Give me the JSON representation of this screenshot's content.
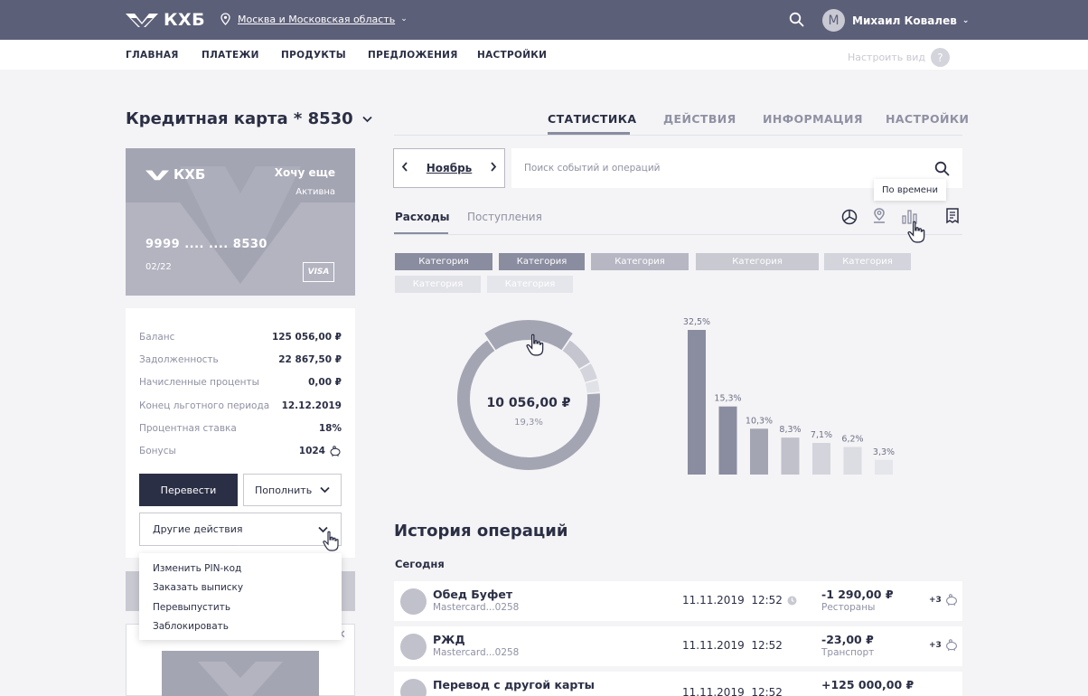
{
  "header": {
    "logo_text": "КХБ",
    "region": "Москва и Московская область",
    "user_initial": "М",
    "user_name": "Михаил Ковалев"
  },
  "nav": {
    "items": [
      {
        "label": "ГЛАВНАЯ"
      },
      {
        "label": "ПЛАТЕЖИ"
      },
      {
        "label": "ПРОДУКТЫ"
      },
      {
        "label": "ПРЕДЛОЖЕНИЯ"
      },
      {
        "label": "НАСТРОЙКИ"
      }
    ],
    "customize_label": "Настроить вид",
    "help_symbol": "?"
  },
  "page": {
    "title": "Кредитная карта * 8530",
    "tabs": [
      {
        "label": "СТАТИСТИКА",
        "active": true
      },
      {
        "label": "ДЕЙСТВИЯ"
      },
      {
        "label": "ИНФОРМАЦИЯ"
      },
      {
        "label": "НАСТРОЙКИ"
      }
    ]
  },
  "card": {
    "logo_text": "КХБ",
    "name": "Хочу еще",
    "status": "Активна",
    "number": "9999 .... .... 8530",
    "expiry": "02/22",
    "brand": "VISA"
  },
  "account": {
    "rows": [
      {
        "label": "Баланс",
        "value": "125 056,00 ₽"
      },
      {
        "label": "Задолженность",
        "value": "22 867,50 ₽"
      },
      {
        "label": "Начисленные проценты",
        "value": "0,00 ₽"
      },
      {
        "label": "Конец льготного периода",
        "value": "12.12.2019"
      },
      {
        "label": "Процентная ставка",
        "value": "18%"
      },
      {
        "label": "Бонусы",
        "value": "1024"
      }
    ],
    "transfer_label": "Перевести",
    "topup_label": "Пополнить",
    "other_label": "Другие действия",
    "other_menu": [
      {
        "label": "Изменить PIN-код"
      },
      {
        "label": "Заказать выписку"
      },
      {
        "label": "Перевыпустить"
      },
      {
        "label": "Заблокировать"
      }
    ]
  },
  "stats": {
    "month": "Ноябрь",
    "search_placeholder": "Поиск событий и операций",
    "tooltip": "По времени",
    "subtabs": [
      {
        "label": "Расходы",
        "active": true
      },
      {
        "label": "Поступления"
      }
    ],
    "chips": [
      {
        "label": "Категория"
      },
      {
        "label": "Категория"
      },
      {
        "label": "Категория"
      },
      {
        "label": "Категория"
      },
      {
        "label": "Категория"
      },
      {
        "label": "Категория"
      },
      {
        "label": "Категория"
      }
    ]
  },
  "chart_data": [
    {
      "type": "pie",
      "title": "",
      "center_value": "10 056,00 ₽",
      "center_percent": "19,3%",
      "values": [
        19.3,
        7.0,
        4.0,
        3.0,
        66.7
      ],
      "colors": [
        "#a4a5b3",
        "#c4c5cf",
        "#d3d4dc",
        "#e1e2e8",
        "#a4a5b3"
      ]
    },
    {
      "type": "bar",
      "title": "",
      "categories": [
        "",
        "",
        "",
        "",
        "",
        "",
        ""
      ],
      "values": [
        32.5,
        15.3,
        10.3,
        8.3,
        7.1,
        6.2,
        3.3
      ],
      "data_labels": [
        "32,5%",
        "15,3%",
        "10,3%",
        "8,3%",
        "7,1%",
        "6,2%",
        "3,3%"
      ],
      "colors": [
        "#8a8ca0",
        "#8a8ca0",
        "#a4a5b3",
        "#c0c1cb",
        "#d3d4dc",
        "#dcdde3",
        "#e5e6eb"
      ],
      "ylim": [
        0,
        32.5
      ]
    }
  ],
  "history": {
    "title": "История операций",
    "today_label": "Сегодня",
    "transactions": [
      {
        "name": "Обед Буфет",
        "account": "Mastercard...0258",
        "date": "11.11.2019",
        "time": "12:52",
        "amount": "-1 290,00 ₽",
        "category": "Рестораны",
        "bonus": "+3"
      },
      {
        "name": "РЖД",
        "account": "Mastercard...0258",
        "date": "11.11.2019",
        "time": "12:52",
        "amount": "-23,00 ₽",
        "category": "Транспорт",
        "bonus": "+3"
      },
      {
        "name": "Перевод с другой карты",
        "account": "",
        "date": "11.11.2019",
        "time": "12:52",
        "amount": "+125 000,00 ₽",
        "category": "",
        "bonus": ""
      }
    ]
  }
}
